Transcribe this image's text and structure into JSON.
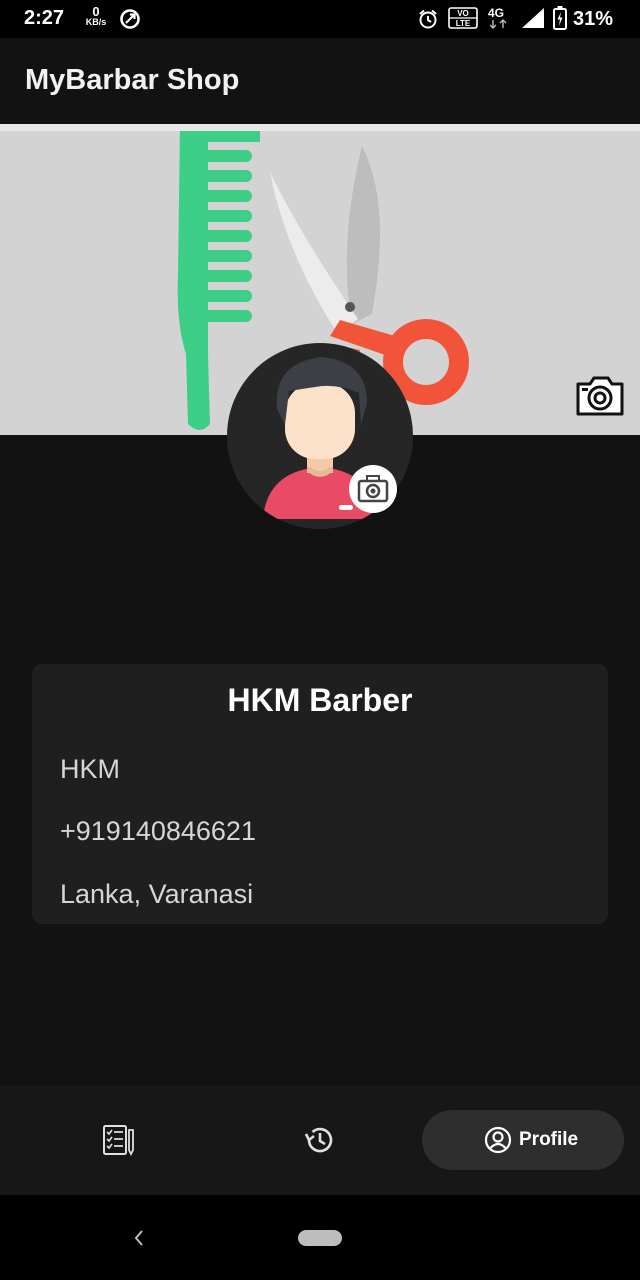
{
  "status_bar": {
    "time": "2:27",
    "net_speed_value": "0",
    "net_speed_unit": "KB/s",
    "network": "4G",
    "volte": "VO LTE",
    "battery": "31%"
  },
  "app_bar": {
    "title": "MyBarbar Shop"
  },
  "profile": {
    "shop_name": "HKM Barber",
    "owner": "HKM",
    "phone": "+919140846621",
    "address": "Lanka, Varanasi"
  },
  "bottom_nav": {
    "items": [
      {
        "icon": "orders-list-icon",
        "label": ""
      },
      {
        "icon": "history-icon",
        "label": ""
      },
      {
        "icon": "profile-icon",
        "label": "Profile",
        "active": true
      }
    ]
  },
  "colors": {
    "background": "#121212",
    "card": "#1f1f1f",
    "comb": "#3ecf86",
    "scissors_handle": "#f2543a",
    "banner": "#d3d3d3"
  }
}
